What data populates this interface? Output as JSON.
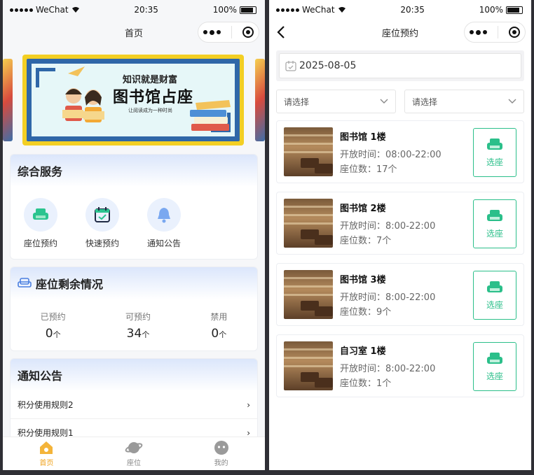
{
  "left": {
    "status": {
      "carrier": "WeChat",
      "time": "20:35",
      "battery": "100%"
    },
    "nav_title": "首页",
    "banner": {
      "subtitle": "知识就是财富",
      "title": "图书馆占座",
      "caption": "让阅读成为一种时尚"
    },
    "services": {
      "title": "综合服务",
      "items": [
        {
          "label": "座位预约",
          "icon": "sofa-icon"
        },
        {
          "label": "快速预约",
          "icon": "calendar-check-icon"
        },
        {
          "label": "通知公告",
          "icon": "bell-icon"
        }
      ]
    },
    "seats": {
      "title": "座位剩余情况",
      "unit": "个",
      "stats": [
        {
          "label": "已预约",
          "value": "0"
        },
        {
          "label": "可预约",
          "value": "34"
        },
        {
          "label": "禁用",
          "value": "0"
        }
      ]
    },
    "notices": {
      "title": "通知公告",
      "items": [
        "积分使用规则2",
        "积分使用规则1"
      ]
    },
    "tabbar": [
      {
        "label": "首页",
        "icon": "home-icon",
        "active": true
      },
      {
        "label": "座位",
        "icon": "planet-icon",
        "active": false
      },
      {
        "label": "我的",
        "icon": "user-face-icon",
        "active": false
      }
    ],
    "colors": {
      "accent": "#f0a31d",
      "banner_border": "#2f67a8",
      "banner_frame": "#f3cf23"
    }
  },
  "right": {
    "status": {
      "carrier": "WeChat",
      "time": "20:35",
      "battery": "100%"
    },
    "nav_title": "座位预约",
    "date": "2025-08-05",
    "filters": [
      {
        "placeholder": "请选择"
      },
      {
        "placeholder": "请选择"
      }
    ],
    "pick_label": "选座",
    "rooms": [
      {
        "name": "图书馆 1楼",
        "hours": "开放时间：08:00-22:00",
        "seats": "座位数：17个"
      },
      {
        "name": "图书馆 2楼",
        "hours": "开放时间：8:00-22:00",
        "seats": "座位数：7个"
      },
      {
        "name": "图书馆 3楼",
        "hours": "开放时间：8:00-22:00",
        "seats": "座位数：9个"
      },
      {
        "name": "自习室 1楼",
        "hours": "开放时间：8:00-22:00",
        "seats": "座位数：1个"
      }
    ],
    "colors": {
      "pick": "#2bbf8a"
    }
  }
}
